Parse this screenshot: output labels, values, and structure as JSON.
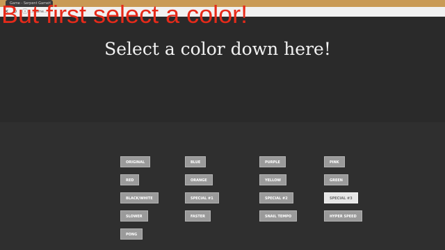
{
  "browser": {
    "tab_title": "Game - Serpent Game",
    "tab_close": "×",
    "url": "...game...",
    "icons": {
      "close": "close-icon",
      "reload": "reload-icon",
      "info": "info-icon"
    }
  },
  "overlay": {
    "caption": "But first select a color!"
  },
  "page": {
    "heading": "Select a color down here!"
  },
  "buttons": {
    "original": "ORIGINAL",
    "blue": "BLUE",
    "purple": "PURPLE",
    "pink": "PINK",
    "red": "RED",
    "orange": "ORANGE",
    "yellow": "YELLOW",
    "green": "GREEN",
    "black_white": "BLACK/WHITE",
    "special1": "SPECIAL #1",
    "special2": "SPECIAL #2",
    "special3": "SPECIAL #3",
    "slower": "SLOWER",
    "faster": "FASTER",
    "snail_tempo": "SNAIL TEMPO",
    "hyper_speed": "HYPER SPEED",
    "pong": "PONG"
  },
  "colors": {
    "overlay_text": "#e62a1a",
    "button_bg": "#9a9a9a",
    "button_selected_bg": "#e6e6e6",
    "page_bg": "#2b2b2b"
  }
}
